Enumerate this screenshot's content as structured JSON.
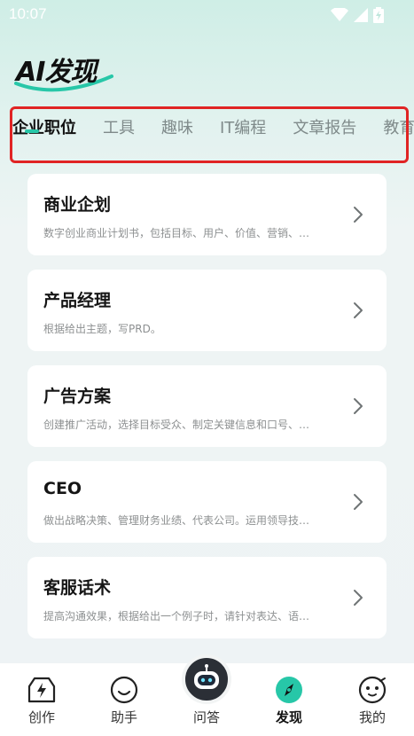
{
  "status_bar": {
    "time": "10:07"
  },
  "header": {
    "logo_text": "AI发现"
  },
  "tabs": [
    {
      "label": "企业职位",
      "active": true
    },
    {
      "label": "工具",
      "active": false
    },
    {
      "label": "趣味",
      "active": false
    },
    {
      "label": "IT编程",
      "active": false
    },
    {
      "label": "文章报告",
      "active": false
    },
    {
      "label": "教育学习",
      "active": false
    }
  ],
  "cards": [
    {
      "title": "商业企划",
      "desc": "数字创业商业计划书，包括目标、用户、价值、营销、…"
    },
    {
      "title": "产品经理",
      "desc": "根据给出主题，写PRD。"
    },
    {
      "title": "广告方案",
      "desc": "创建推广活动，选择目标受众、制定关键信息和口号、…"
    },
    {
      "title": "CEO",
      "desc": "做出战略决策、管理财务业绩、代表公司。运用领导技…"
    },
    {
      "title": "客服话术",
      "desc": "提高沟通效果，根据给出一个例子时，请针对表达、语…"
    }
  ],
  "bottom_nav": [
    {
      "label": "创作",
      "icon": "lightning-box-icon"
    },
    {
      "label": "助手",
      "icon": "smile-face-icon"
    },
    {
      "label": "问答",
      "icon": "robot-icon"
    },
    {
      "label": "发现",
      "icon": "compass-icon",
      "active": true
    },
    {
      "label": "我的",
      "icon": "profile-face-icon"
    }
  ],
  "colors": {
    "accent": "#27c7a8",
    "highlight_box": "#e02424"
  }
}
